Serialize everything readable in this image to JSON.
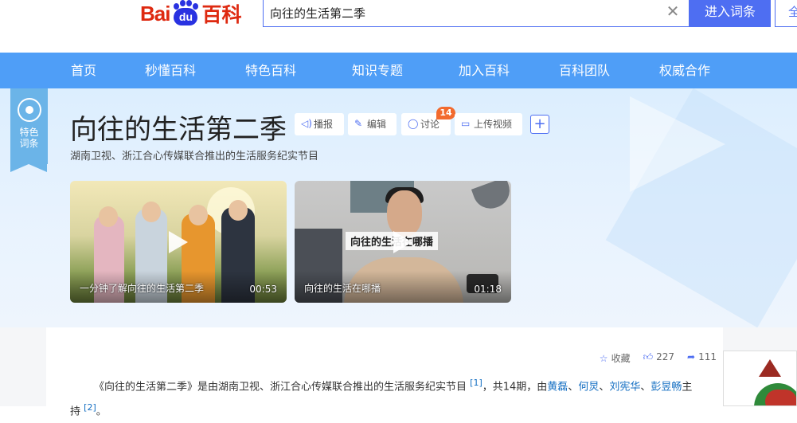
{
  "header": {
    "logo_bai": "Bai",
    "logo_du": "du",
    "logo_baike": "百科",
    "search_value": "向往的生活第二季",
    "enter_button": "进入词条",
    "all_button": "全"
  },
  "nav": {
    "items": [
      "首页",
      "秒懂百科",
      "特色百科",
      "知识专题",
      "加入百科",
      "百科团队",
      "权威合作"
    ]
  },
  "entry": {
    "ribbon_text_1": "特色",
    "ribbon_text_2": "词条",
    "title": "向往的生活第二季",
    "actions": {
      "report": "播报",
      "edit": "编辑",
      "discuss": "讨论",
      "discuss_count": "14",
      "upload_video": "上传视频"
    },
    "subtitle": "湖南卫视、浙江合心传媒联合推出的生活服务纪实节目",
    "videos": [
      {
        "label": "一分钟了解向往的生活第二季",
        "duration": "00:53"
      },
      {
        "label": "向往的生活在哪播",
        "duration": "01:18",
        "caption": "向往的生活在哪播"
      }
    ]
  },
  "article": {
    "collect": "收藏",
    "likes": "227",
    "shares": "111",
    "para_text_1": "《向往的生活第二季》是由湖南卫视、浙江合心传媒联合推出的生活服务纪实节目",
    "ref1": "[1]",
    "para_text_2": "，共14期，由",
    "host1": "黄磊",
    "sep1": "、",
    "host2": "何炅",
    "sep2": "、",
    "host3": "刘宪华",
    "sep3": "、",
    "host4": "彭昱畅",
    "para_text_3": "主持",
    "ref2": "[2]",
    "para_end": "。"
  },
  "colors": {
    "brand_blue": "#4e6ef2",
    "nav_blue": "#4f9ef7",
    "logo_red": "#de2910",
    "badge_orange": "#f26a2e",
    "link_blue": "#136ec2"
  }
}
